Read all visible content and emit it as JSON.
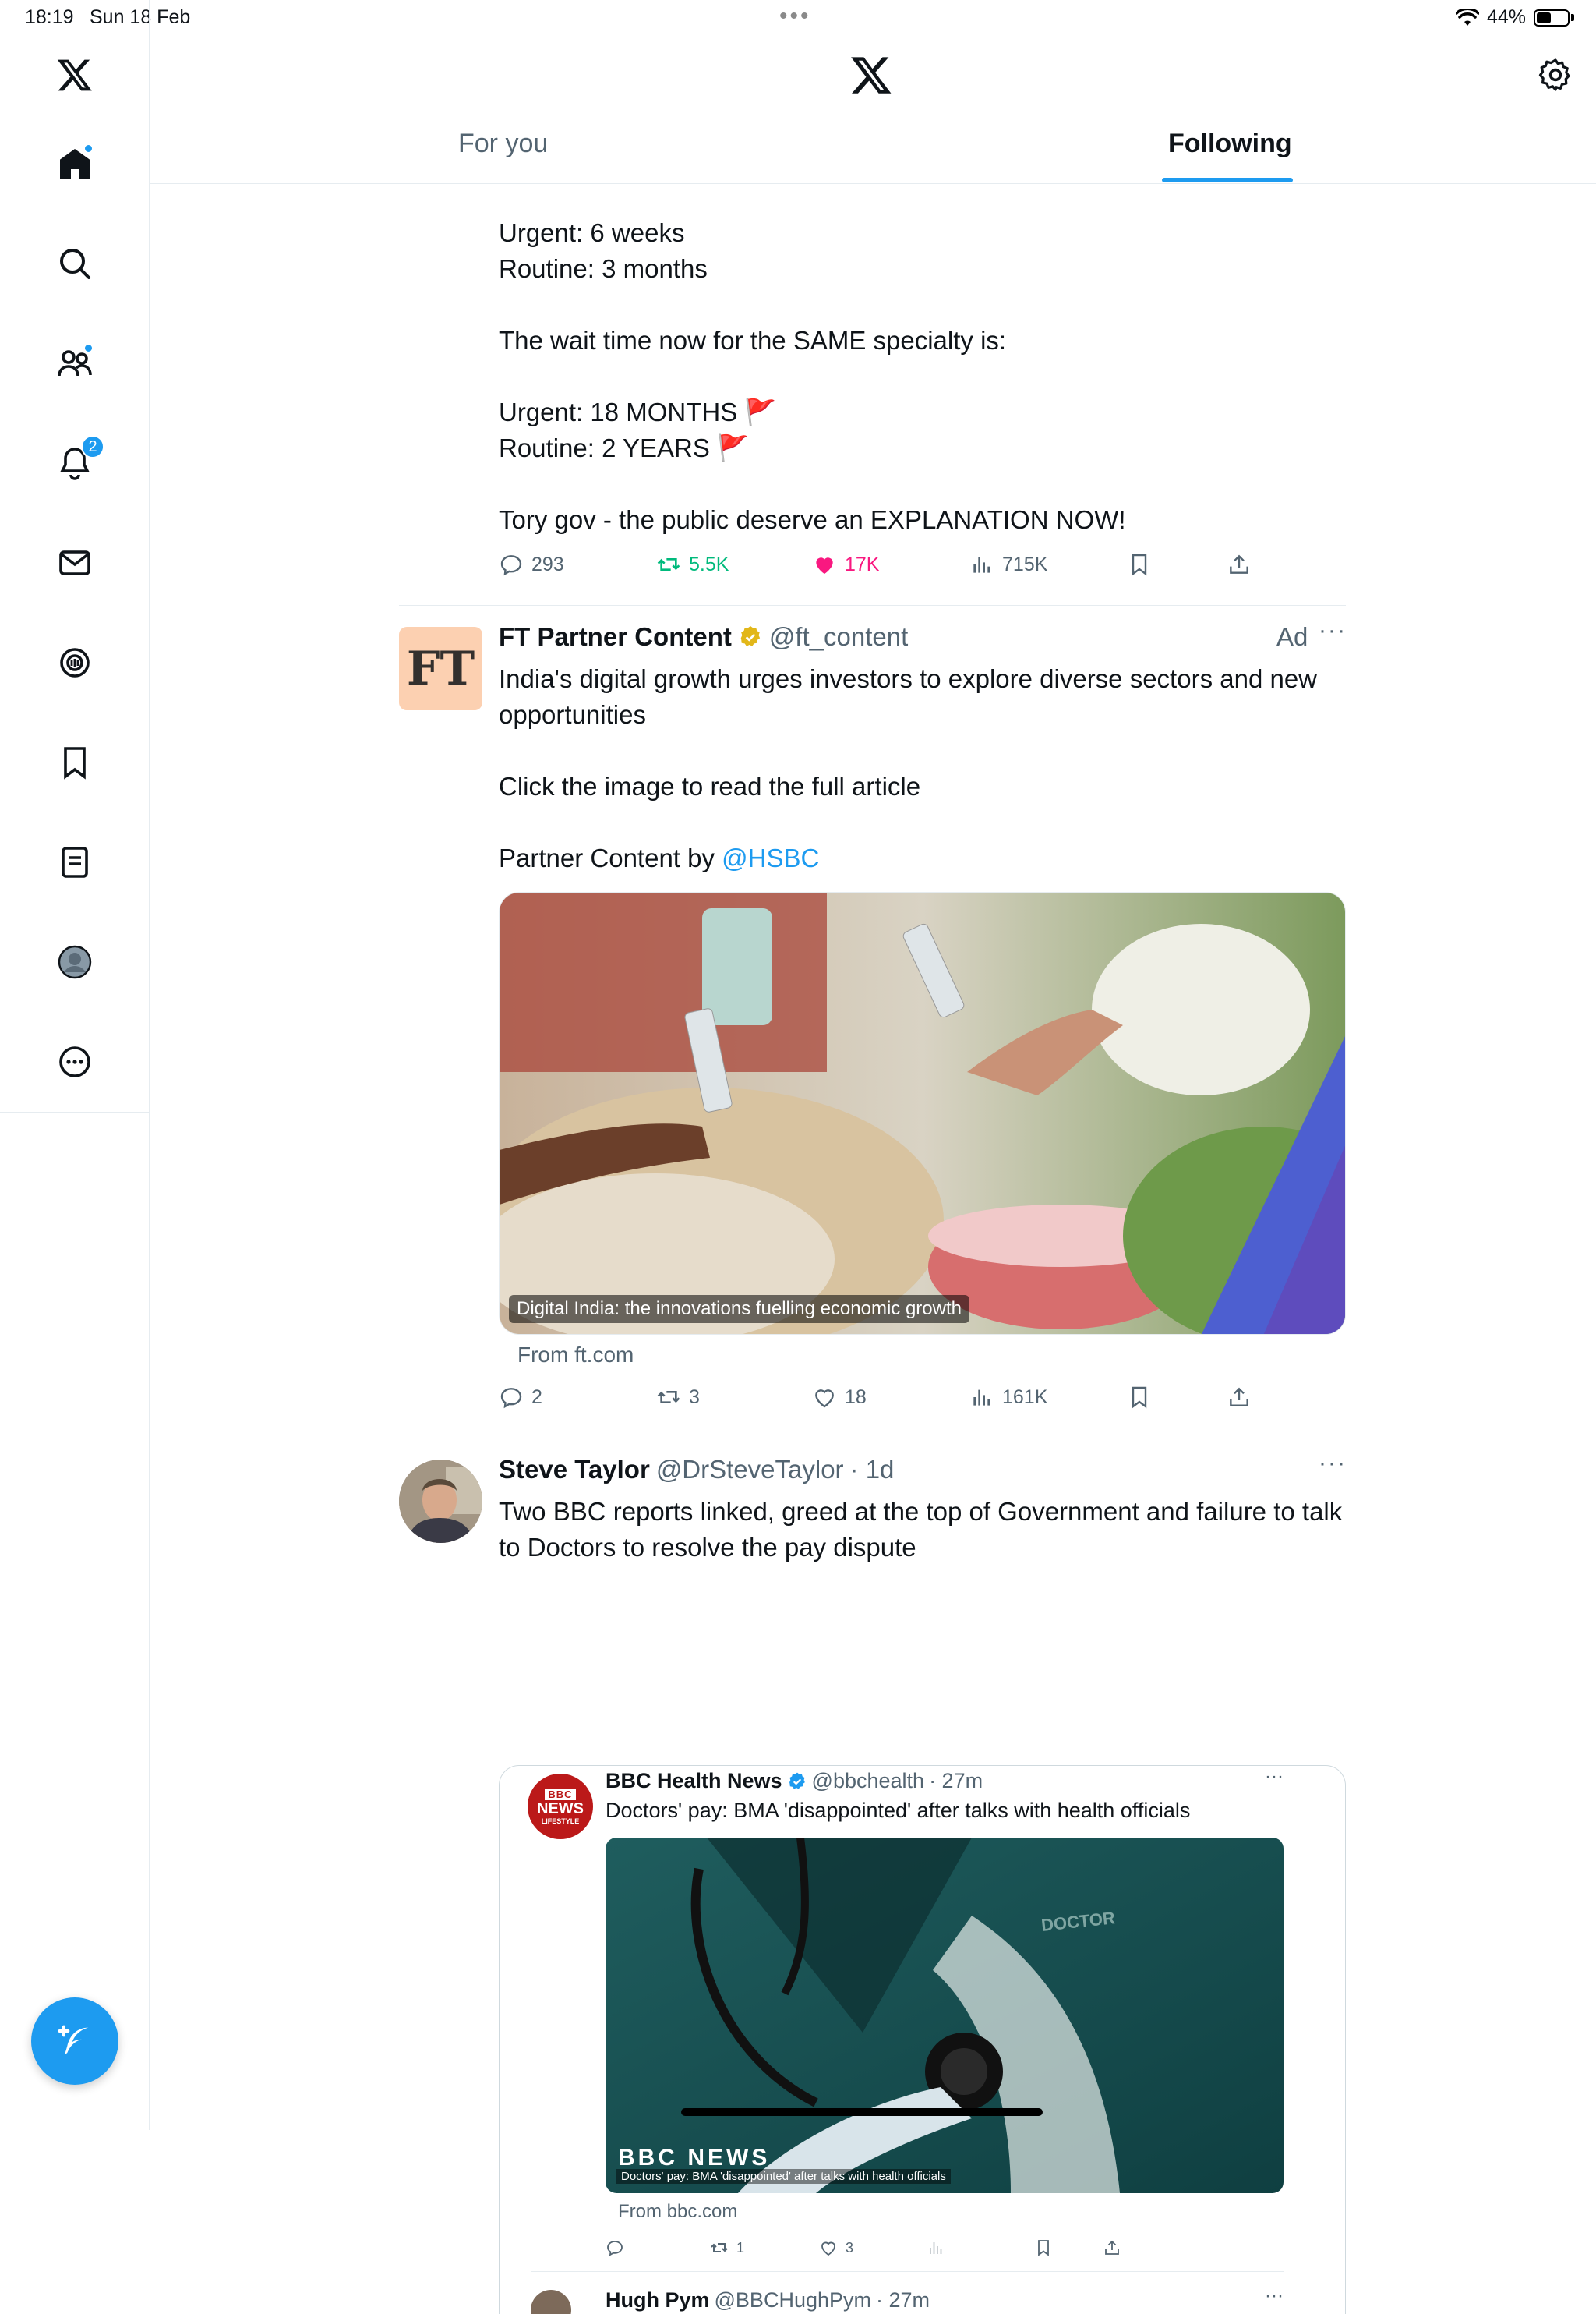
{
  "status_bar": {
    "time": "18:19",
    "date": "Sun 18 Feb",
    "battery": "44%"
  },
  "header": {
    "tabs": {
      "for_you": "For you",
      "following": "Following"
    }
  },
  "nav": {
    "notifications_count": "2"
  },
  "post1": {
    "lines": [
      "Urgent: 6 weeks",
      "Routine: 3 months",
      "",
      "The wait time now for the SAME specialty is:",
      "",
      "Urgent: 18 MONTHS 🚩",
      "Routine: 2 YEARS 🚩",
      "",
      "Tory gov - the public deserve an EXPLANATION NOW!"
    ],
    "replies": "293",
    "reposts": "5.5K",
    "likes": "17K",
    "views": "715K"
  },
  "post2": {
    "name": "FT Partner Content",
    "handle": "@ft_content",
    "ad_label": "Ad",
    "avatar_text": "FT",
    "text1": "India's digital growth urges investors to explore diverse sectors and new opportunities",
    "text2": "Click the image to read the full article",
    "text3_prefix": "Partner Content by ",
    "text3_link": "@HSBC",
    "media_caption": "Digital India: the innovations fuelling economic growth",
    "source": "From ft.com",
    "replies": "2",
    "reposts": "3",
    "likes": "18",
    "views": "161K"
  },
  "post3": {
    "name": "Steve Taylor",
    "handle": "@DrSteveTaylor",
    "time": "· 1d",
    "text": "Two BBC reports linked, greed at the top of Government and failure to talk to Doctors to resolve the pay dispute",
    "quote": {
      "name": "BBC Health News",
      "handle": "@bbchealth",
      "time": "· 27m",
      "avatar_lines": [
        "BBC",
        "NEWS",
        "LIFESTYLE"
      ],
      "text": "Doctors' pay: BMA 'disappointed' after talks with health officials",
      "media_caption": "Doctors' pay: BMA 'disappointed' after talks with health officials",
      "media_brand": "BBC NEWS",
      "scrub_label": "DOCTOR",
      "source": "From bbc.com",
      "reposts": "1",
      "likes": "3",
      "next_name": "Hugh Pym",
      "next_handle": "@BBCHughPym",
      "next_time": "· 27m"
    }
  },
  "colors": {
    "accent": "#1d9bf0",
    "repost": "#00ba7c",
    "like": "#f91880",
    "muted": "#536471"
  }
}
